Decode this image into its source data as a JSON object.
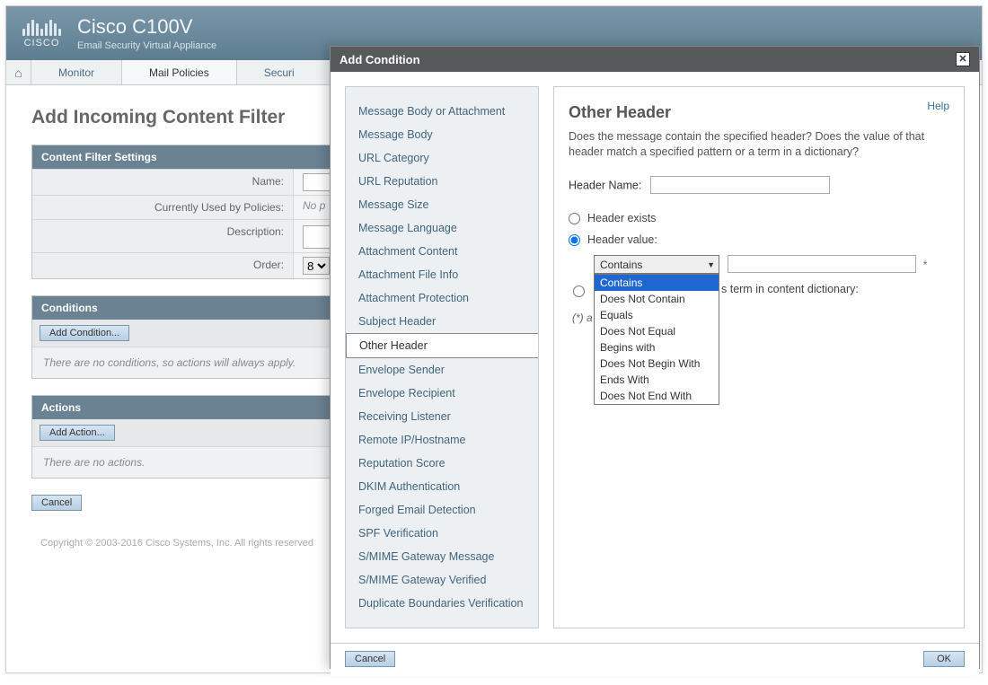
{
  "header": {
    "logo_text": "CISCO",
    "product": "Cisco C100V",
    "subtitle": "Email Security Virtual Appliance"
  },
  "nav": {
    "tabs": [
      "Monitor",
      "Mail Policies",
      "Securi"
    ]
  },
  "page": {
    "title": "Add Incoming Content Filter",
    "settings_header": "Content Filter Settings",
    "name_label": "Name:",
    "currently_label": "Currently Used by Policies:",
    "currently_value": "No p",
    "description_label": "Description:",
    "order_label": "Order:",
    "order_value": "8",
    "conditions_header": "Conditions",
    "add_condition_btn": "Add Condition...",
    "conditions_empty": "There are no conditions, so actions will always apply.",
    "actions_header": "Actions",
    "add_action_btn": "Add Action...",
    "actions_empty": "There are no actions.",
    "cancel_btn": "Cancel",
    "footer": "Copyright © 2003-2016 Cisco Systems, Inc. All rights reserved"
  },
  "modal": {
    "title": "Add Condition",
    "help": "Help",
    "conditions": [
      "Message Body or Attachment",
      "Message Body",
      "URL Category",
      "URL Reputation",
      "Message Size",
      "Message Language",
      "Attachment Content",
      "Attachment File Info",
      "Attachment Protection",
      "Subject Header",
      "Other Header",
      "Envelope Sender",
      "Envelope Recipient",
      "Receiving Listener",
      "Remote IP/Hostname",
      "Reputation Score",
      "DKIM Authentication",
      "Forged Email Detection",
      "SPF Verification",
      "S/MIME Gateway Message",
      "S/MIME Gateway Verified",
      "Duplicate Boundaries Verification"
    ],
    "selected_condition": "Other Header",
    "detail": {
      "title": "Other Header",
      "desc": "Does the message contain the specified header? Does the value of that header match a specified pattern or a term in a dictionary?",
      "header_name_label": "Header Name:",
      "radio_exists": "Header exists",
      "radio_value": "Header value:",
      "select_value": "Contains",
      "options": [
        "Contains",
        "Does Not Contain",
        "Equals",
        "Does Not Equal",
        "Begins with",
        "Does Not Begin With",
        "Ends With",
        "Does Not End With"
      ],
      "dict_text_suffix": "s term in content dictionary:",
      "note_prefix": "(*) a",
      "cancel": "Cancel",
      "ok": "OK"
    }
  }
}
